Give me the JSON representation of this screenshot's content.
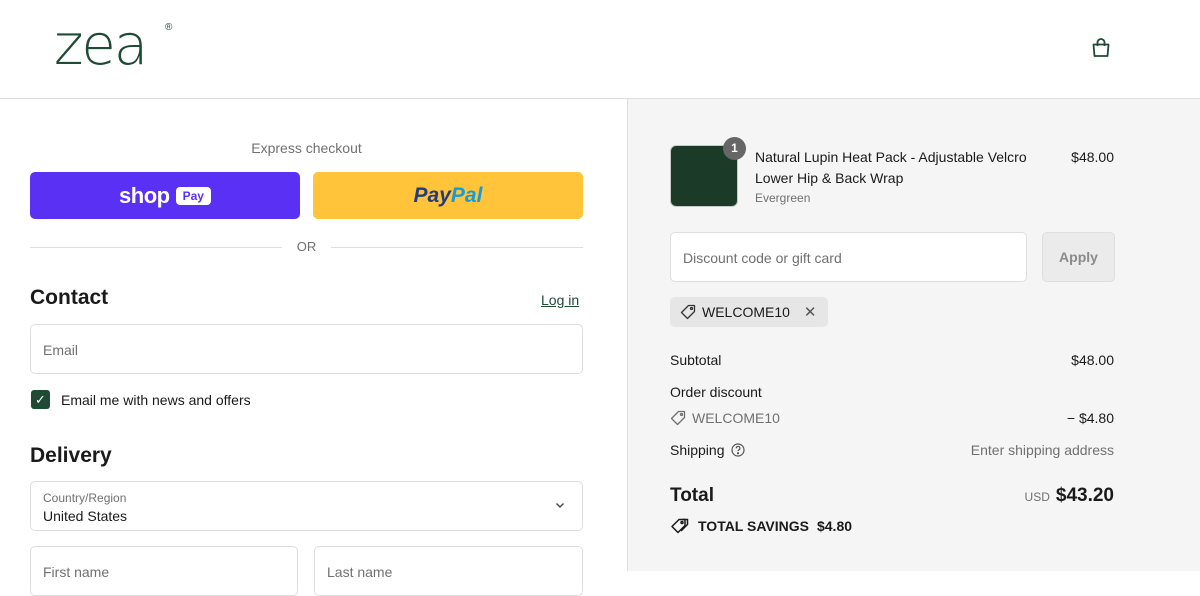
{
  "brand": {
    "logo_text": "zea",
    "registered_mark": "®"
  },
  "header": {
    "cart_icon": "shopping-bag-icon"
  },
  "express": {
    "label": "Express checkout",
    "shop_pay": {
      "word": "shop",
      "pill": "Pay"
    },
    "paypal": {
      "part1": "Pay",
      "part2": "Pal"
    },
    "or_label": "OR"
  },
  "contact": {
    "heading": "Contact",
    "login_link": "Log in",
    "email_placeholder": "Email",
    "newsletter_label": "Email me with news and offers",
    "newsletter_checked": true
  },
  "delivery": {
    "heading": "Delivery",
    "country_label": "Country/Region",
    "country_value": "United States",
    "first_name_placeholder": "First name",
    "last_name_placeholder": "Last name"
  },
  "order": {
    "item": {
      "quantity": "1",
      "title": "Natural Lupin Heat Pack - Adjustable Velcro Lower Hip & Back Wrap",
      "variant": "Evergreen",
      "price": "$48.00",
      "thumb_color": "#1b3a27"
    },
    "discount_placeholder": "Discount code or gift card",
    "apply_label": "Apply",
    "applied_code": "WELCOME10",
    "subtotal_label": "Subtotal",
    "subtotal_value": "$48.00",
    "order_discount_label": "Order discount",
    "discount_code": "WELCOME10",
    "discount_value": "− $4.80",
    "shipping_label": "Shipping",
    "shipping_value": "Enter shipping address",
    "total_label": "Total",
    "total_currency": "USD",
    "total_value": "$43.20",
    "savings_label": "TOTAL SAVINGS",
    "savings_value": "$4.80"
  },
  "colors": {
    "brand_green": "#1f4a36",
    "shop_pay": "#5a31f4",
    "paypal": "#ffc439"
  }
}
